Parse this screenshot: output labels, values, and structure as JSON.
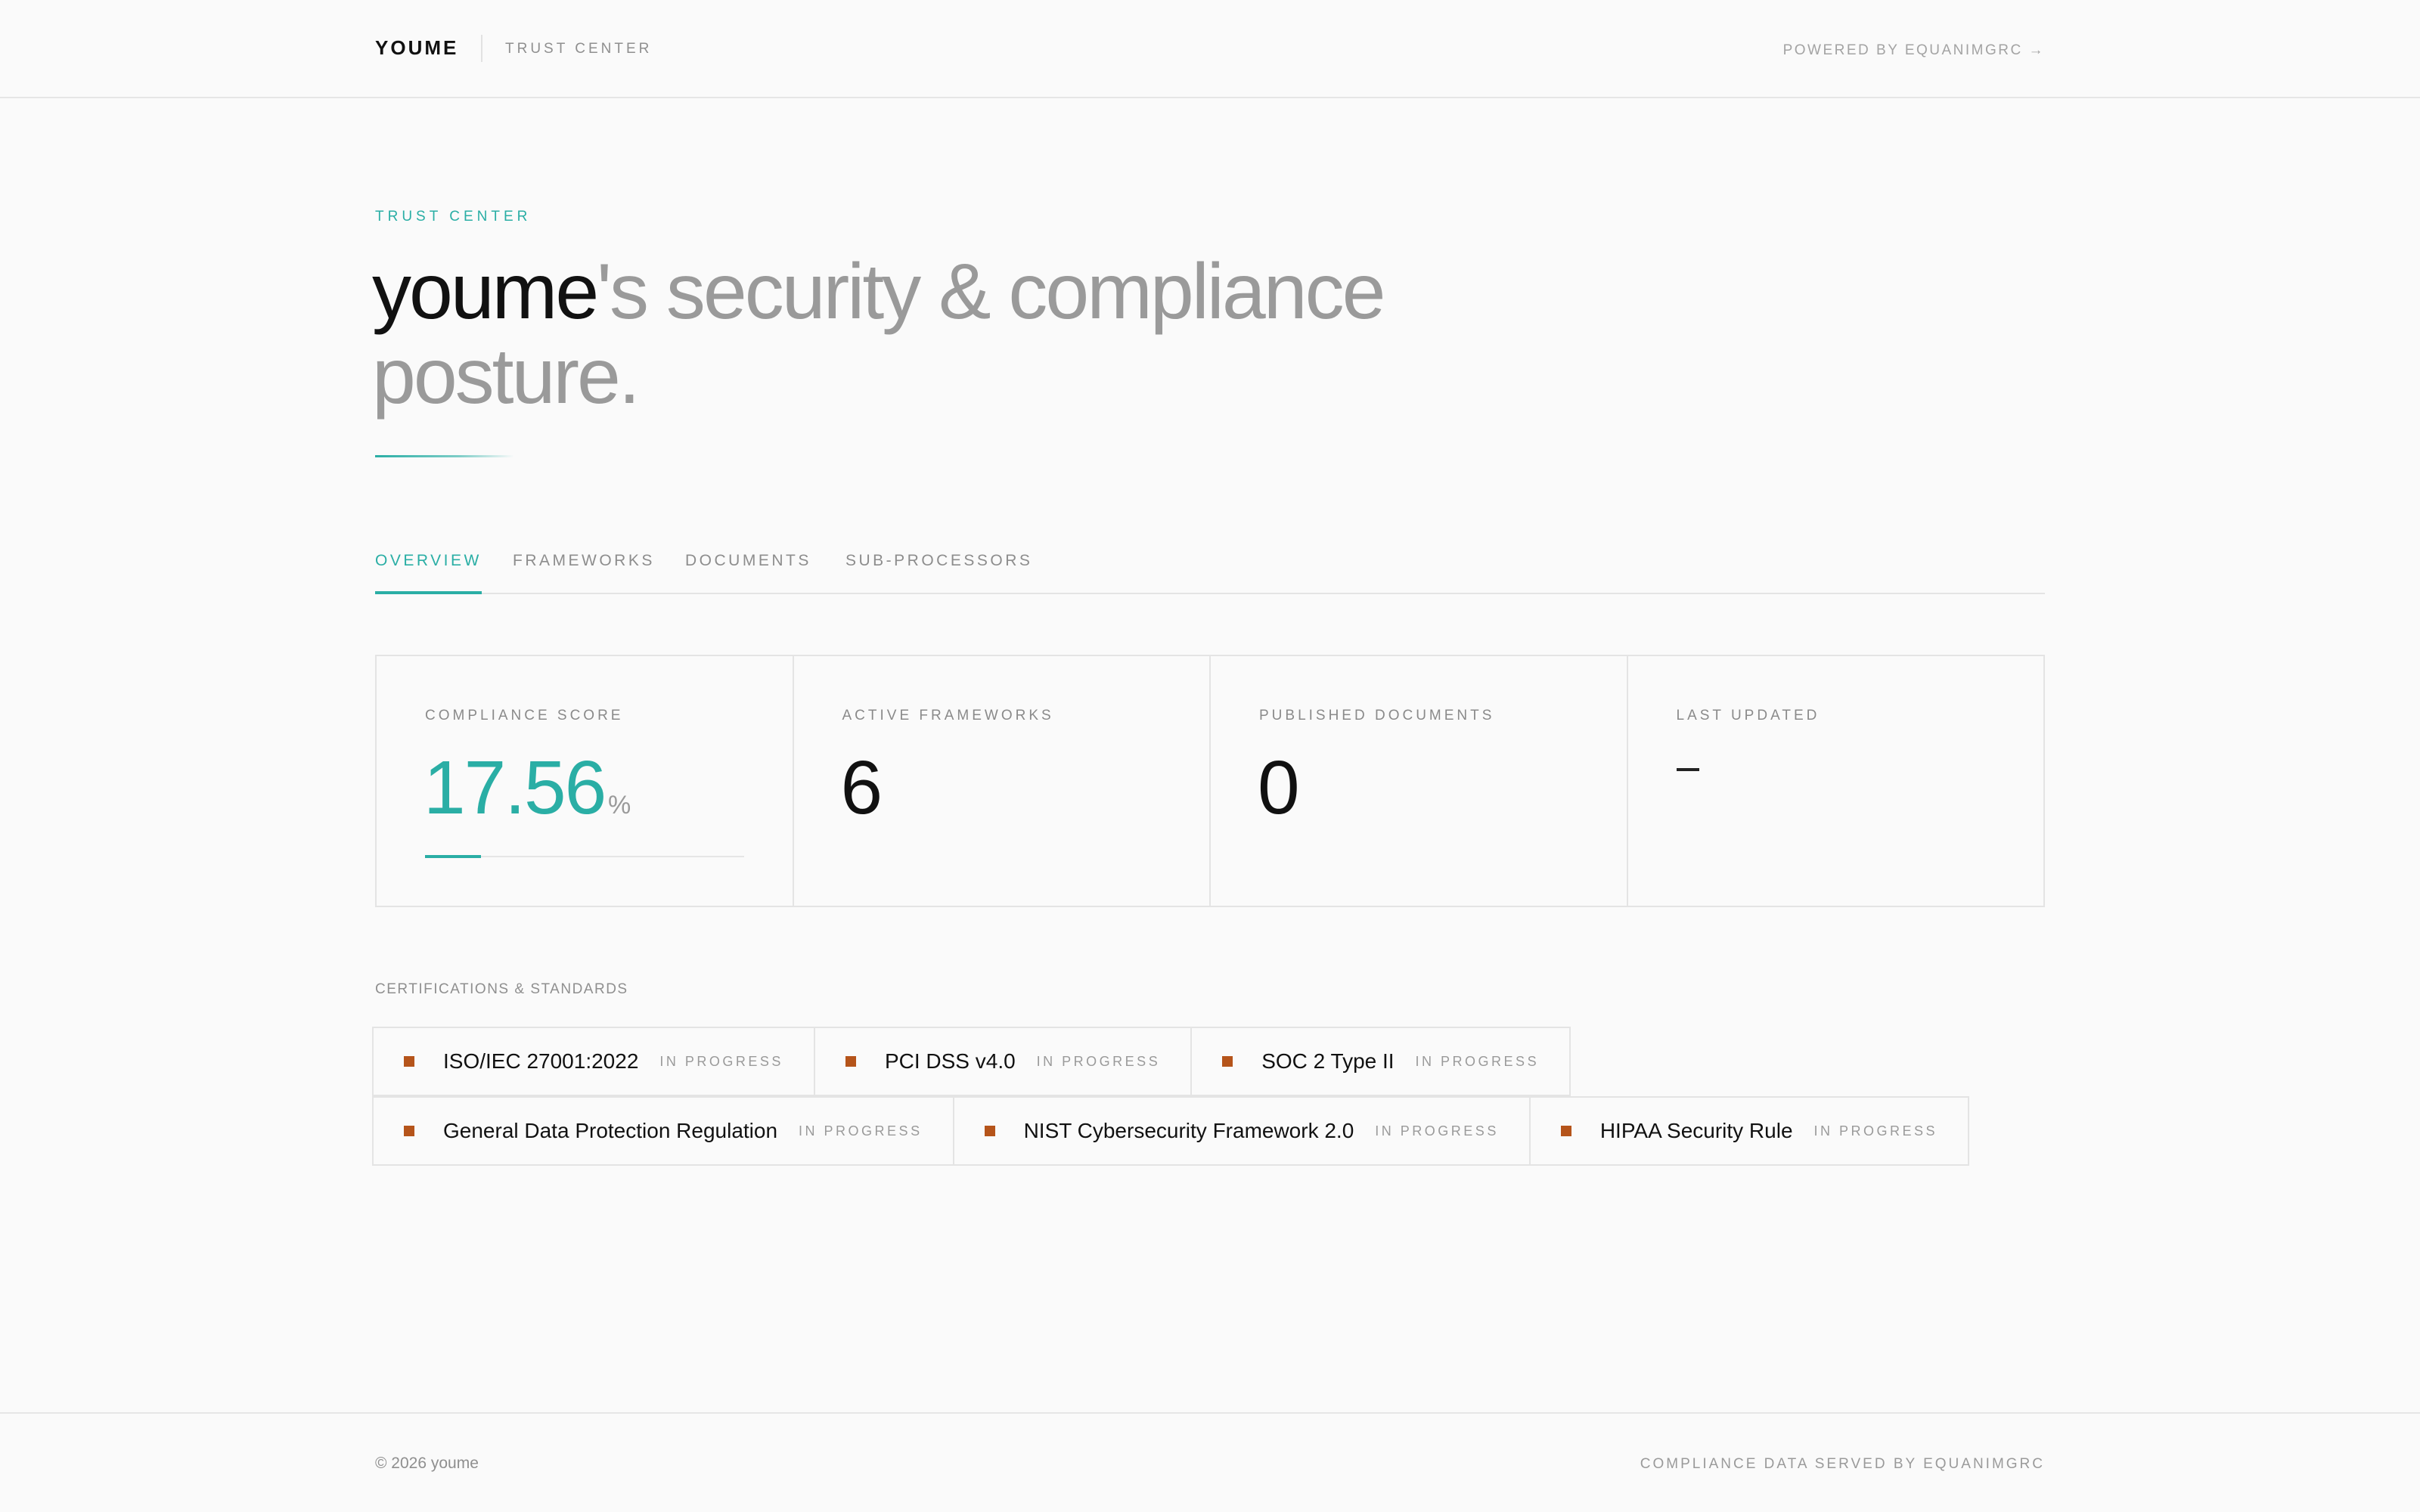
{
  "header": {
    "brand": "YOUME",
    "subtitle": "TRUST CENTER",
    "powered_by": "POWERED BY EQUANIMGRC →"
  },
  "hero": {
    "eyebrow": "TRUST CENTER",
    "org": "youme",
    "headline_rest": "'s security & compliance posture."
  },
  "tabs": [
    {
      "label": "OVERVIEW",
      "active": true
    },
    {
      "label": "FRAMEWORKS",
      "active": false
    },
    {
      "label": "DOCUMENTS",
      "active": false
    },
    {
      "label": "SUB-PROCESSORS",
      "active": false
    }
  ],
  "stats": {
    "compliance_score": {
      "label": "COMPLIANCE SCORE",
      "value": "17.56",
      "unit": "%",
      "progress_fraction": 0.1756
    },
    "active_frameworks": {
      "label": "ACTIVE FRAMEWORKS",
      "value": "6"
    },
    "published_documents": {
      "label": "PUBLISHED DOCUMENTS",
      "value": "0"
    },
    "last_updated": {
      "label": "LAST UPDATED",
      "value": "–"
    }
  },
  "certifications": {
    "heading": "CERTIFICATIONS & STANDARDS",
    "status_color": "#b5541a",
    "items": [
      {
        "name": "ISO/IEC 27001:2022",
        "status": "IN PROGRESS"
      },
      {
        "name": "PCI DSS v4.0",
        "status": "IN PROGRESS"
      },
      {
        "name": "SOC 2 Type II",
        "status": "IN PROGRESS"
      },
      {
        "name": "General Data Protection Regulation",
        "status": "IN PROGRESS"
      },
      {
        "name": "NIST Cybersecurity Framework 2.0",
        "status": "IN PROGRESS"
      },
      {
        "name": "HIPAA Security Rule",
        "status": "IN PROGRESS"
      }
    ]
  },
  "footer": {
    "copyright": "© 2026 youme",
    "served_by": "COMPLIANCE DATA SERVED BY EQUANIMGRC"
  },
  "colors": {
    "accent": "#2aaea5",
    "text": "#111111",
    "muted": "#9a9a9a",
    "background": "#fafafa"
  }
}
